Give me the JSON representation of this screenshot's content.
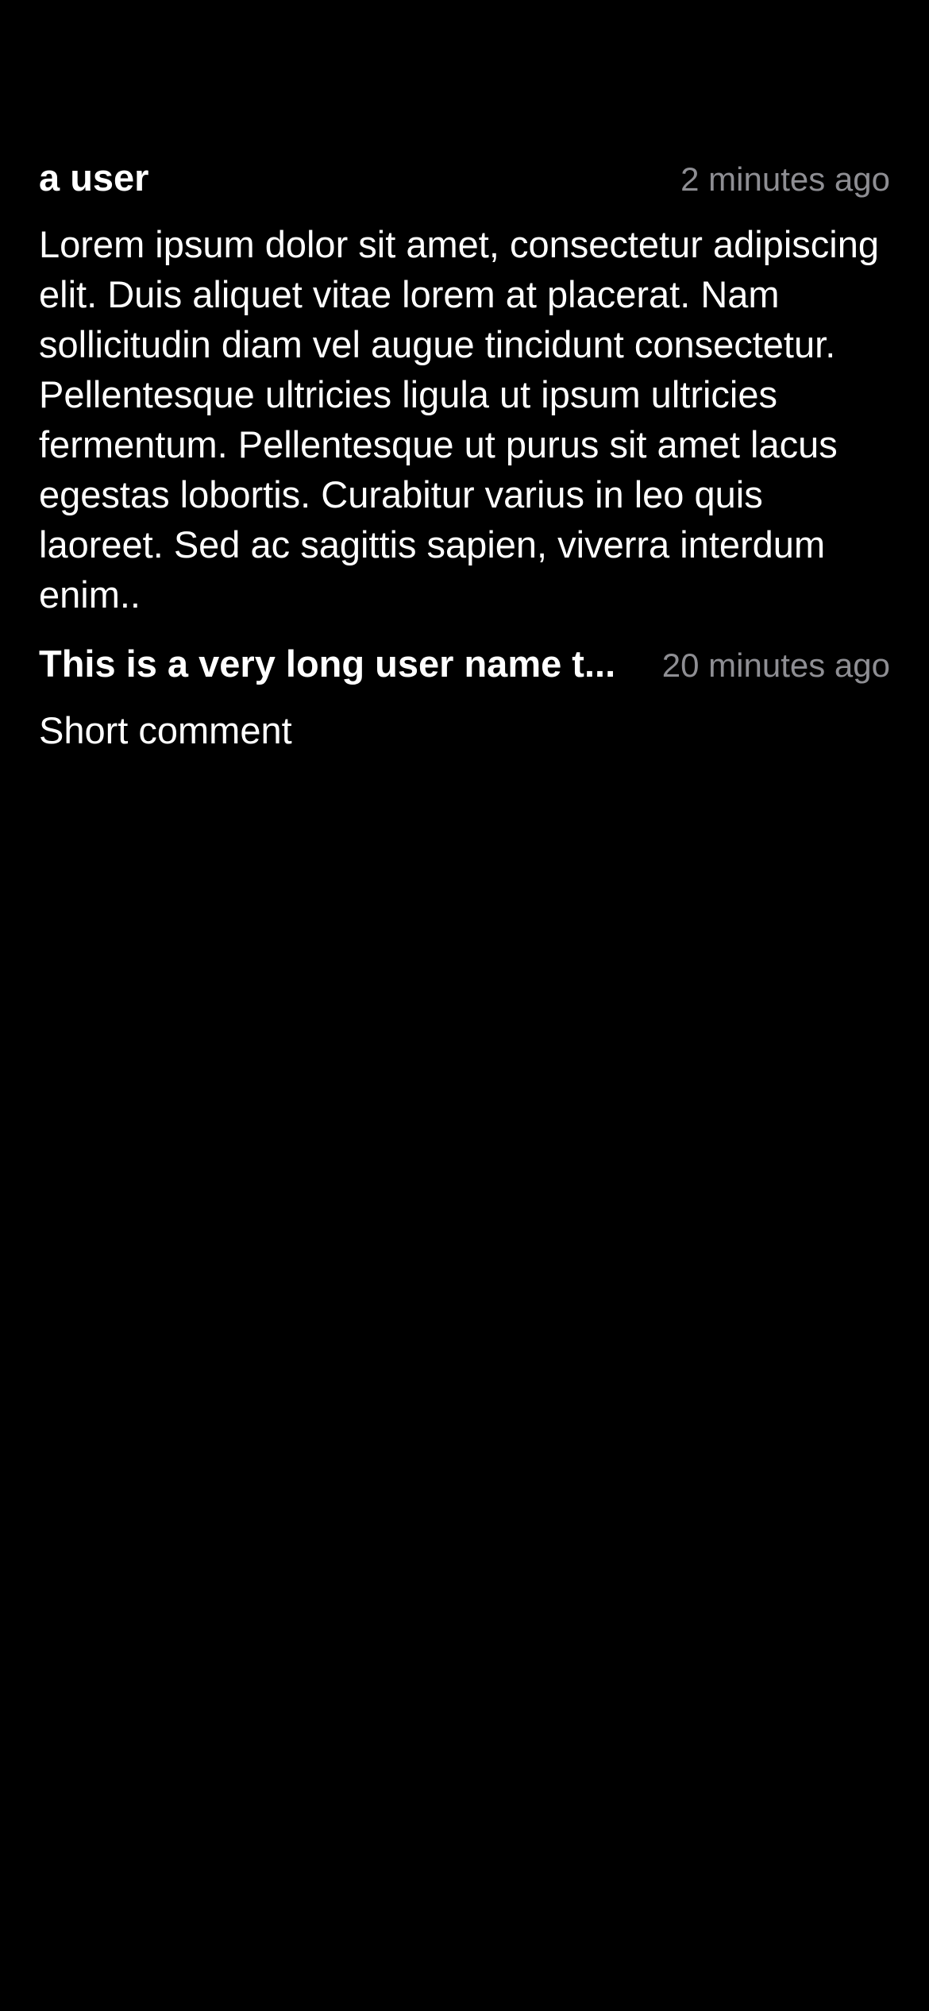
{
  "comments": [
    {
      "author": "a user",
      "timestamp": "2 minutes ago",
      "body": "Lorem ipsum dolor sit amet, consectetur adipiscing elit. Duis aliquet vitae lorem at placerat. Nam sollicitudin diam vel augue tincidunt consectetur. Pellentesque ultricies ligula ut ipsum ultricies fermentum. Pellentesque ut purus sit amet lacus egestas lobortis. Curabitur varius in leo quis laoreet. Sed ac sagittis sapien, viverra interdum enim.."
    },
    {
      "author": "This is a very long user name t...",
      "timestamp": "20 minutes ago",
      "body": "Short comment"
    }
  ],
  "colors": {
    "background": "#000000",
    "primary_text": "#ffffff",
    "secondary_text": "#8e8e93"
  }
}
